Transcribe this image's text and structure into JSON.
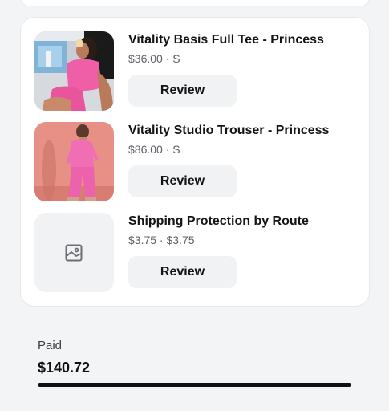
{
  "line_items": [
    {
      "title": "Vitality Basis Full Tee - Princess",
      "meta": "$36.00 · S",
      "review_label": "Review",
      "image": "pink-tee-photo"
    },
    {
      "title": "Vitality Studio Trouser - Princess",
      "meta": "$86.00 · S",
      "review_label": "Review",
      "image": "pink-trouser-photo"
    },
    {
      "title": "Shipping Protection by Route",
      "meta": "$3.75 · $3.75",
      "review_label": "Review",
      "image": "image-placeholder-icon"
    }
  ],
  "payment": {
    "label": "Paid",
    "amount": "$140.72",
    "progress": 1.0
  },
  "colors": {
    "button_bg": "#f1f2f4",
    "card_bg": "#ffffff",
    "page_bg": "#f3f4f6",
    "progress_fill": "#111111"
  }
}
